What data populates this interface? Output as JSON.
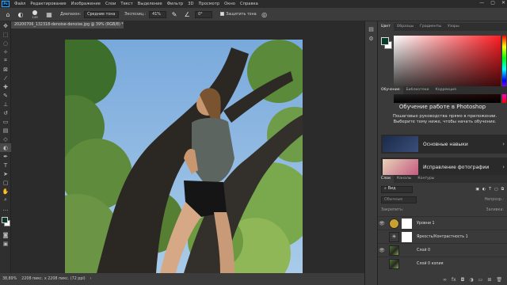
{
  "menu": {
    "logo": "Ps",
    "items": [
      "Файл",
      "Редактирование",
      "Изображение",
      "Слои",
      "Текст",
      "Выделение",
      "Фильтр",
      "3D",
      "Просмотр",
      "Окно",
      "Справка"
    ],
    "window_controls": [
      "—",
      "▢",
      "✕"
    ]
  },
  "options": {
    "brush_size": "149",
    "range_label": "Диапазон:",
    "range_value": "Средние тона",
    "exposure_label": "Экспозиц.:",
    "exposure_value": "41%",
    "angle_value": "0°",
    "protect_tones": "Защитить тона"
  },
  "document": {
    "tab_title": "20200706_132318-denoise-denoise.jpg @ 39% (RGB/8) *",
    "zoom": "38,89%",
    "status": "2208 пикс. x 2208 пикс. (72 ppi)"
  },
  "color_panel": {
    "tabs": [
      "Цвет",
      "Образцы",
      "Градиенты",
      "Узоры"
    ],
    "foreground": "#0a3a2a",
    "background": "#ffffff"
  },
  "learn_panel": {
    "tabs": [
      "Обучение",
      "Библиотеки",
      "Коррекция"
    ],
    "title": "Обучение работе в Photoshop",
    "subtitle": "Пошаговые руководства прямо в приложении. Выберите тему ниже, чтобы начать обучение.",
    "cards": [
      "Основные навыки",
      "Исправление фотографии"
    ]
  },
  "layers_panel": {
    "tabs": [
      "Слои",
      "Каналы",
      "Контуры"
    ],
    "search_kind": "Вид",
    "blend_mode": "Обычные",
    "opacity_label": "Непрозр.:",
    "lock_label": "Закрепить:",
    "fill_label": "Заливка:",
    "layers": [
      {
        "name": "Уровни 1",
        "visible": true
      },
      {
        "name": "Яркость/Контрастность 1",
        "visible": false
      },
      {
        "name": "Слой 0",
        "visible": true
      },
      {
        "name": "Слой 0 копия",
        "visible": false
      }
    ]
  }
}
